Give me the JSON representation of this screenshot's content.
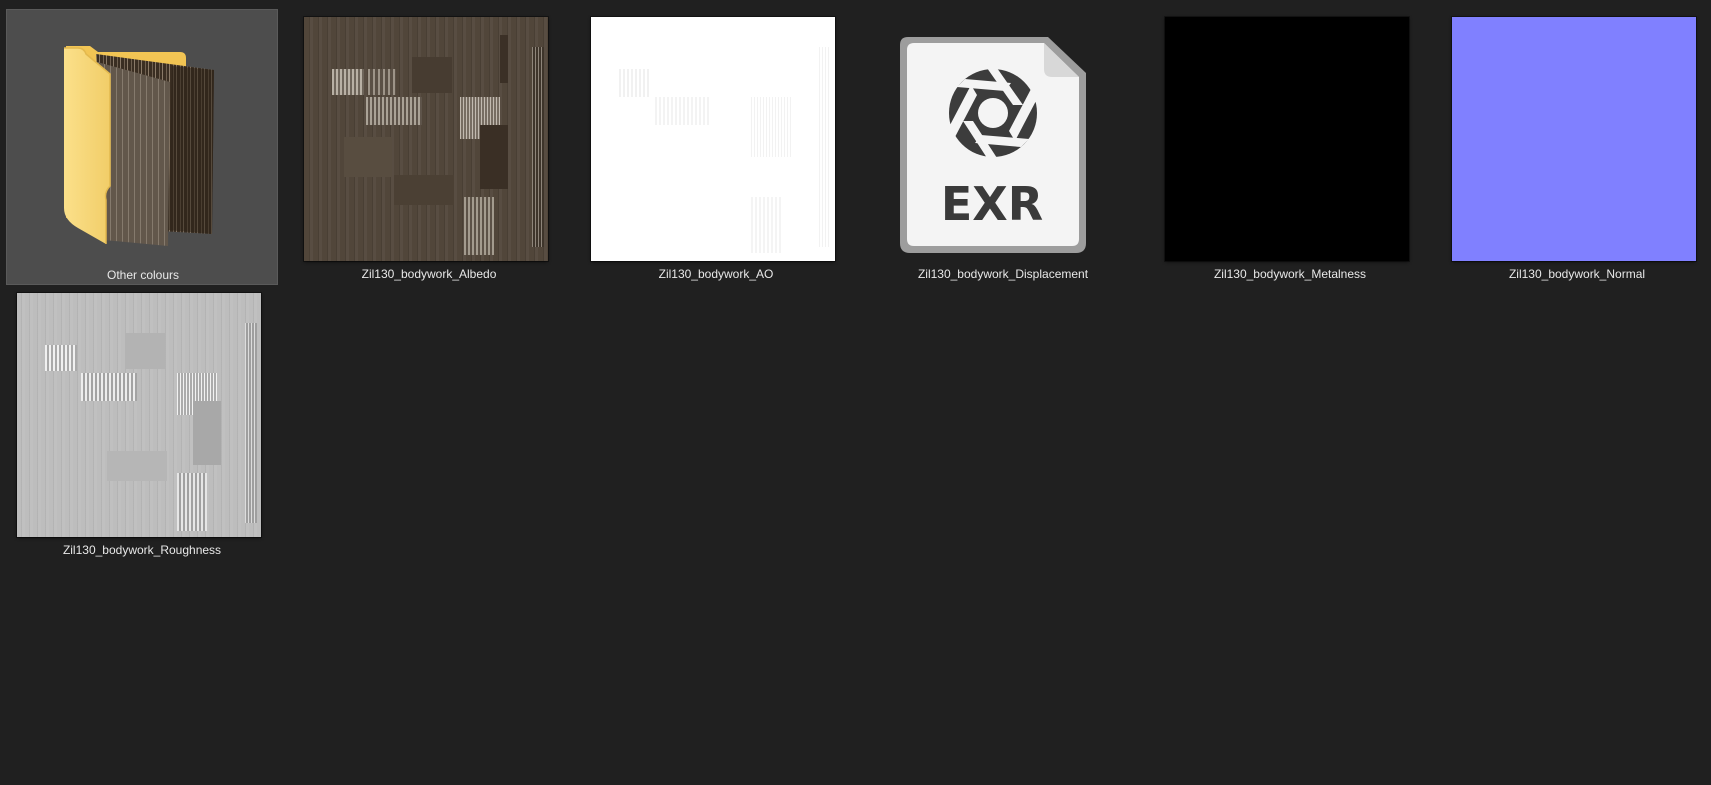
{
  "files": [
    {
      "name": "Other colours",
      "type": "folder",
      "selected": true
    },
    {
      "name": "Zil130_bodywork_Albedo",
      "type": "image",
      "preview_color": "#51463a"
    },
    {
      "name": "Zil130_bodywork_AO",
      "type": "image",
      "preview_color": "#ffffff"
    },
    {
      "name": "Zil130_bodywork_Displacement",
      "type": "exr",
      "icon_text": "EXR"
    },
    {
      "name": "Zil130_bodywork_Metalness",
      "type": "image",
      "preview_color": "#000000"
    },
    {
      "name": "Zil130_bodywork_Normal",
      "type": "image",
      "preview_color": "#8080ff"
    },
    {
      "name": "Zil130_bodywork_Roughness",
      "type": "image",
      "preview_color": "#bdbdbd"
    }
  ],
  "colors": {
    "background": "#202020",
    "selection": "#4d4d4d",
    "folder_yellow": "#f8d775",
    "label_text": "#e8e8e8"
  }
}
